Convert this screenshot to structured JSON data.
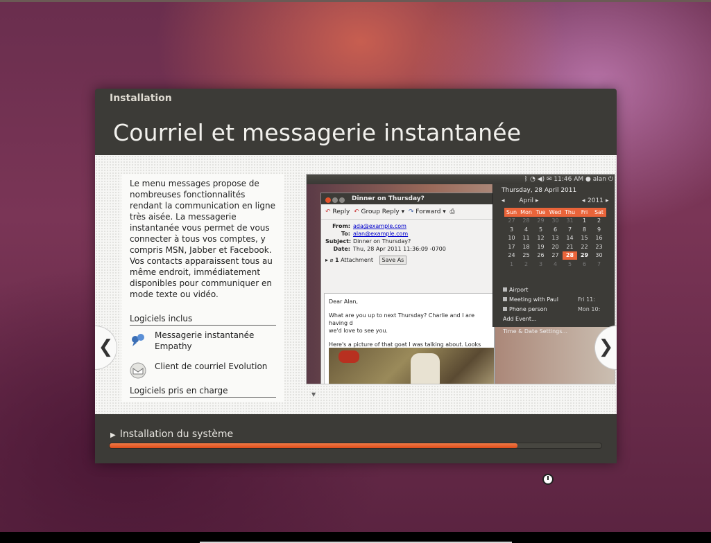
{
  "window": {
    "title": "Installation"
  },
  "slide": {
    "heading": "Courriel et messagerie instantanée",
    "description": "Le menu messages propose de nombreuses fonctionnalités rendant la communication en ligne très aisée. La messagerie instantanée vous permet de vous connecter à tous vos comptes, y compris MSN, Jabber et Facebook. Vos contacts apparaissent tous au même endroit, immédiatement disponibles pour communiquer en mode texte ou vidéo.",
    "included_title": "Logiciels inclus",
    "apps": [
      {
        "label": "Messagerie instantanée Empathy",
        "icon": "empathy-icon"
      },
      {
        "label": "Client de courriel Evolution",
        "icon": "evolution-icon"
      }
    ],
    "supported_title": "Logiciels pris en charge",
    "prev_glyph": "❮",
    "next_glyph": "❯"
  },
  "screenshot": {
    "panel_time": "11:46 AM",
    "panel_user": "alan",
    "mail": {
      "title": "Dinner on Thursday?",
      "reply": "Reply",
      "group_reply": "Group Reply",
      "forward": "Forward",
      "from_key": "From:",
      "from": "ada@example.com",
      "to_key": "To:",
      "to": "alan@example.com",
      "subject_key": "Subject:",
      "subject": "Dinner on Thursday?",
      "date_key": "Date:",
      "date": "Thu, 28 Apr 2011 11:36:09 -0700",
      "attachment_count": "1",
      "attachment_label": "Attachment",
      "save_as": "Save As",
      "greeting": "Dear Alan,",
      "line1": "What are you up to next Thursday? Charlie and I are having d",
      "line2": "we'd love to see you.",
      "line3": "Here's a picture of that goat I was talking about. Looks com"
    },
    "calendar": {
      "date": "Thursday, 28 April 2011",
      "month": "April",
      "year": "2011",
      "days": [
        "Sun",
        "Mon",
        "Tue",
        "Wed",
        "Thu",
        "Fri",
        "Sat"
      ],
      "weeks": [
        [
          "27",
          "28",
          "29",
          "30",
          "31",
          "1",
          "2"
        ],
        [
          "3",
          "4",
          "5",
          "6",
          "7",
          "8",
          "9"
        ],
        [
          "10",
          "11",
          "12",
          "13",
          "14",
          "15",
          "16"
        ],
        [
          "17",
          "18",
          "19",
          "20",
          "21",
          "22",
          "23"
        ],
        [
          "24",
          "25",
          "26",
          "27",
          "28",
          "29",
          "30"
        ],
        [
          "1",
          "2",
          "3",
          "4",
          "5",
          "6",
          "7"
        ]
      ],
      "events": [
        {
          "name": "Airport",
          "time": ""
        },
        {
          "name": "Meeting with Paul",
          "time": "Fri 11:"
        },
        {
          "name": "Phone person",
          "time": "Mon 10:"
        }
      ],
      "add_event": "Add Event...",
      "settings": "Time & Date Settings..."
    }
  },
  "progress": {
    "label": "Installation du système",
    "value": 0.83,
    "color": "#e9643a"
  }
}
